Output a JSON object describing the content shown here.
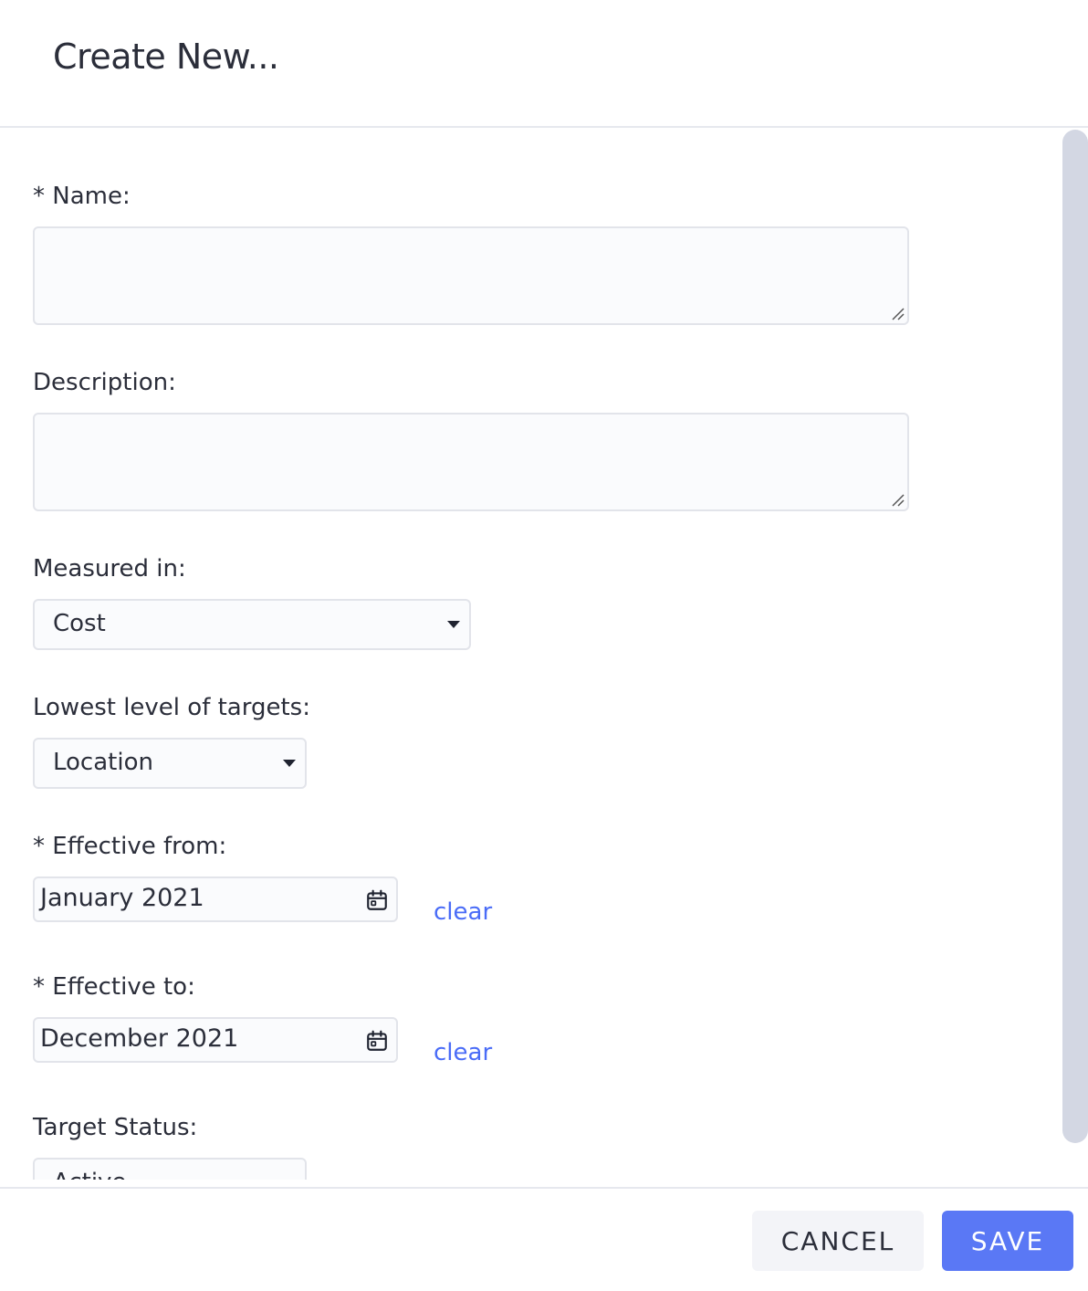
{
  "dialog": {
    "title": "Create New..."
  },
  "form": {
    "name": {
      "label": "* Name:",
      "value": ""
    },
    "description": {
      "label": "Description:",
      "value": ""
    },
    "measured_in": {
      "label": "Measured in:",
      "value": "Cost"
    },
    "lowest_level": {
      "label": "Lowest level of targets:",
      "value": "Location"
    },
    "effective_from": {
      "label": "* Effective from:",
      "value": "January 2021",
      "clear_label": "clear"
    },
    "effective_to": {
      "label": "* Effective to:",
      "value": "December 2021",
      "clear_label": "clear"
    },
    "target_status": {
      "label": "Target Status:",
      "value": "Active"
    }
  },
  "footer": {
    "cancel_label": "CANCEL",
    "save_label": "SAVE"
  },
  "colors": {
    "accent": "#5a78f5",
    "link": "#4a6cf7",
    "border": "#e2e4ea"
  },
  "icons": {
    "date_picker": "calendar-icon",
    "dropdown": "caret-down-icon",
    "resize": "resize-grip-icon"
  }
}
